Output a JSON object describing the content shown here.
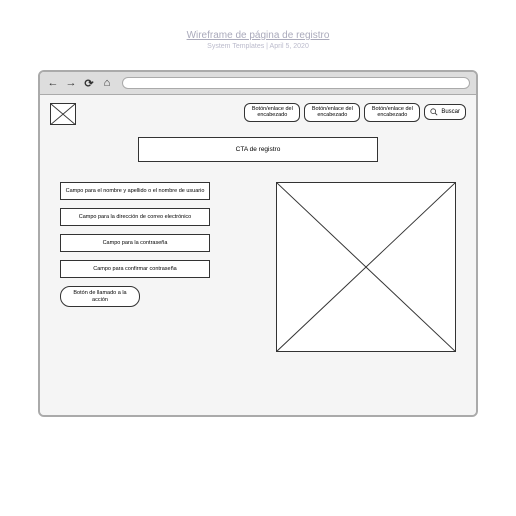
{
  "doc": {
    "title": "Wireframe de página de registro",
    "meta": "System Templates | April 5, 2020"
  },
  "browser": {
    "nav": {
      "back": "←",
      "forward": "→",
      "reload": "⟳",
      "home": "⌂"
    }
  },
  "header": {
    "links": [
      "Botón/enlace del encabezado",
      "Botón/enlace del encabezado",
      "Botón/enlace del encabezado"
    ],
    "search": "Buscar"
  },
  "cta_banner": "CTA de registro",
  "form": {
    "fields": [
      "Campo para el nombre y apellido o el nombre de usuario",
      "Campo para la dirección de correo electrónico",
      "Campo para la contraseña",
      "Campo para confirmar contraseña"
    ],
    "action_button": "Botón de llamado a la acción"
  }
}
